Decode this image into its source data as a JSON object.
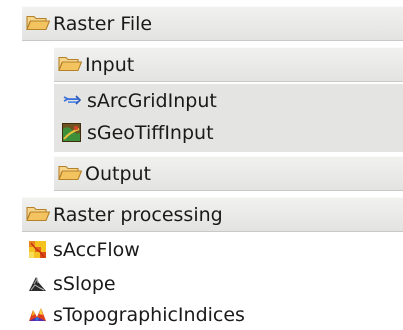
{
  "palette": {
    "raster_file": {
      "label": "Raster File",
      "icon": "open-folder-icon",
      "input": {
        "label": "Input",
        "icon": "open-folder-icon",
        "tools": [
          {
            "label": "sArcGridInput",
            "icon": "arc-grid-input-icon"
          },
          {
            "label": "sGeoTiffInput",
            "icon": "geotiff-input-icon"
          }
        ]
      },
      "output": {
        "label": "Output",
        "icon": "open-folder-icon"
      }
    },
    "raster_processing": {
      "label": "Raster processing",
      "icon": "open-folder-icon",
      "tools": [
        {
          "label": "sAccFlow",
          "icon": "acc-flow-icon"
        },
        {
          "label": "sSlope",
          "icon": "slope-icon"
        },
        {
          "label": "sTopographicIndices",
          "icon": "topographic-indices-icon"
        }
      ]
    }
  },
  "colors": {
    "drawer_bg": "#e8e8e6",
    "folder": "#e0a43a",
    "text": "#1a1a1a"
  }
}
